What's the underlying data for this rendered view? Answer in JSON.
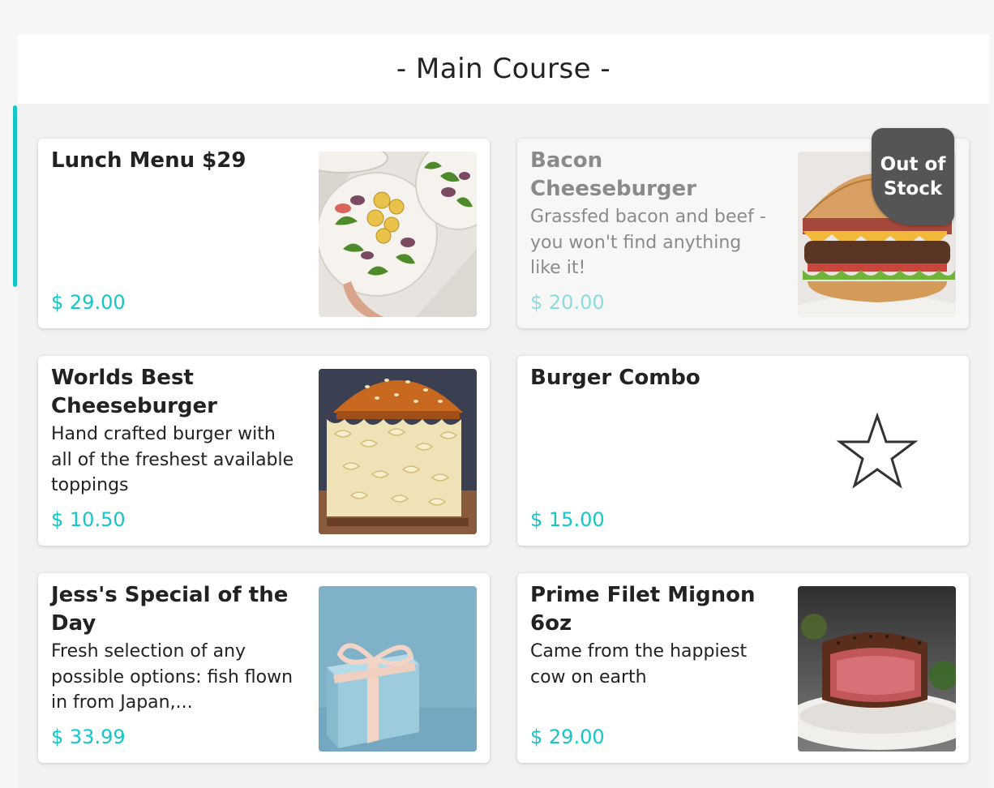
{
  "section": {
    "title": "- Main Course -"
  },
  "items": [
    {
      "name": "Lunch Menu $29",
      "description": "",
      "price": "$ 29.00",
      "image": "salad-plates-photo",
      "out_of_stock": false
    },
    {
      "name": "Bacon Cheeseburger",
      "description": "Grassfed bacon and beef - you won't find anything like it!",
      "price": "$ 20.00",
      "image": "bacon-cheeseburger-photo",
      "out_of_stock": true,
      "badge": "Out of Stock"
    },
    {
      "name": "Worlds Best Cheeseburger",
      "description": "Hand crafted burger with all of the freshest available toppings",
      "price": "$ 10.50",
      "image": "mac-cheese-burger-photo",
      "out_of_stock": false
    },
    {
      "name": "Burger Combo",
      "description": "",
      "price": "$ 15.00",
      "image": "star-icon",
      "out_of_stock": false
    },
    {
      "name": "Jess's Special of the Day",
      "description": "Fresh selection of any possible options: fish flown in from Japan,...",
      "price": "$ 33.99",
      "image": "gift-box-photo",
      "out_of_stock": false
    },
    {
      "name": "Prime Filet Mignon 6oz",
      "description": "Came from the happiest cow on earth",
      "price": "$ 29.00",
      "image": "filet-mignon-photo",
      "out_of_stock": false
    }
  ],
  "colors": {
    "accent": "#16c5c8",
    "badge": "#555555",
    "text": "#222222",
    "disabled_text": "#8a8a8a"
  }
}
